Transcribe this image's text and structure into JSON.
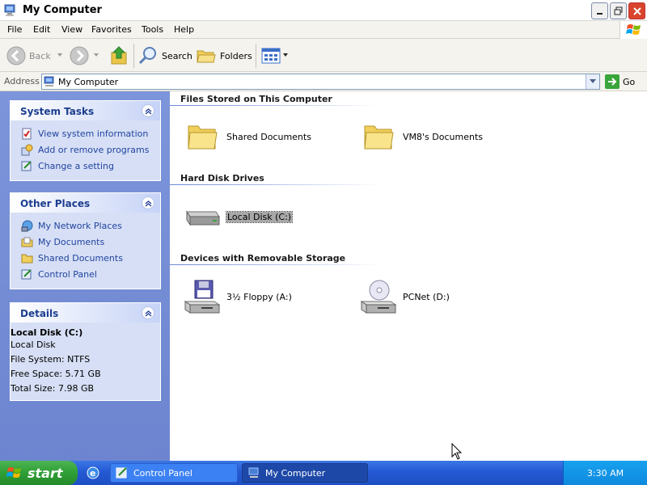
{
  "window": {
    "title": "My Computer"
  },
  "menu": [
    "File",
    "Edit",
    "View",
    "Favorites",
    "Tools",
    "Help"
  ],
  "toolbar": {
    "back": "Back",
    "search": "Search",
    "folders": "Folders"
  },
  "address": {
    "label": "Address",
    "value": "My Computer",
    "go": "Go"
  },
  "system_tasks": {
    "title": "System Tasks",
    "items": [
      "View system information",
      "Add or remove programs",
      "Change a setting"
    ]
  },
  "other_places": {
    "title": "Other Places",
    "items": [
      "My Network Places",
      "My Documents",
      "Shared Documents",
      "Control Panel"
    ]
  },
  "details": {
    "title": "Details",
    "name": "Local Disk (C:)",
    "type": "Local Disk",
    "filesystem": "File System: NTFS",
    "free": "Free Space: 5.71 GB",
    "total": "Total Size: 7.98 GB"
  },
  "groups": {
    "files": {
      "title": "Files Stored on This Computer",
      "items": [
        "Shared Documents",
        "VM8's Documents"
      ]
    },
    "hdd": {
      "title": "Hard Disk Drives",
      "items": [
        "Local Disk (C:)"
      ]
    },
    "removable": {
      "title": "Devices with Removable Storage",
      "items": [
        "3½ Floppy (A:)",
        "PCNet (D:)"
      ]
    }
  },
  "taskbar": {
    "start": "start",
    "tasks": [
      "Control Panel",
      "My Computer"
    ],
    "clock": "3:30 AM"
  },
  "colors": {
    "taskbar_blue": "#2459d4",
    "start_green": "#2f9e36",
    "link_blue": "#2244a0",
    "panel_blue": "#7c95da"
  }
}
